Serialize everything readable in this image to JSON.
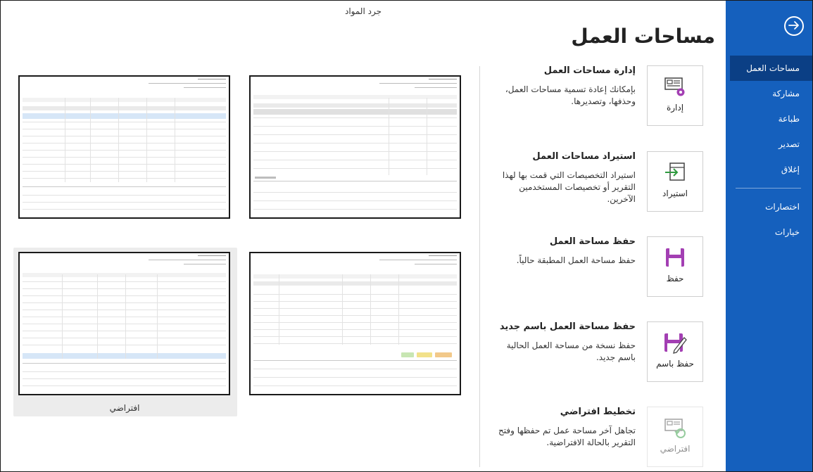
{
  "window": {
    "title": "جرد المواد"
  },
  "sidebar": {
    "back_icon": "arrow-right-circle-icon",
    "items": [
      {
        "label": "مساحات العمل",
        "active": true
      },
      {
        "label": "مشاركة"
      },
      {
        "label": "طباعة"
      },
      {
        "label": "تصدير"
      },
      {
        "label": "إغلاق"
      }
    ],
    "items2": [
      {
        "label": "اختصارات"
      },
      {
        "label": "خيارات"
      }
    ]
  },
  "main": {
    "title": "مساحات العمل",
    "actions": [
      {
        "title": "إدارة مساحات العمل",
        "desc": "بإمكانك إعادة تسمية مساحات العمل، وحذفها، وتصديرها.",
        "button": "إدارة",
        "icon": "manage-workspace-icon"
      },
      {
        "title": "استيراد مساحات العمل",
        "desc": "استيراد التخصيصات التي قمت بها لهذا التقرير أو تخصيصات المستخدمين الآخرين.",
        "button": "استيراد",
        "icon": "import-icon"
      },
      {
        "title": "حفظ مساحة العمل",
        "desc": "حفظ مساحة العمل المطبقة حالياً.",
        "button": "حفظ",
        "icon": "save-icon"
      },
      {
        "title": "حفظ مساحة العمل باسم جديد",
        "desc": "حفظ نسخة من مساحة العمل الحالية باسم جديد.",
        "button": "حفظ باسم",
        "icon": "save-as-icon"
      },
      {
        "title": "تخطيط افتراضي",
        "desc": "تجاهل آخر مساحة عمل تم حفظها وفتح التقرير بالحالة الافتراضية.",
        "button": "افتراضي",
        "icon": "reset-layout-icon",
        "disabled": true
      }
    ]
  },
  "thumbnails": [
    {
      "caption": "افتراضي",
      "selected": true
    }
  ],
  "colors": {
    "sidebar": "#1560bd",
    "sidebar_active": "#0b3f85",
    "accent_purple": "#a33fb3"
  }
}
